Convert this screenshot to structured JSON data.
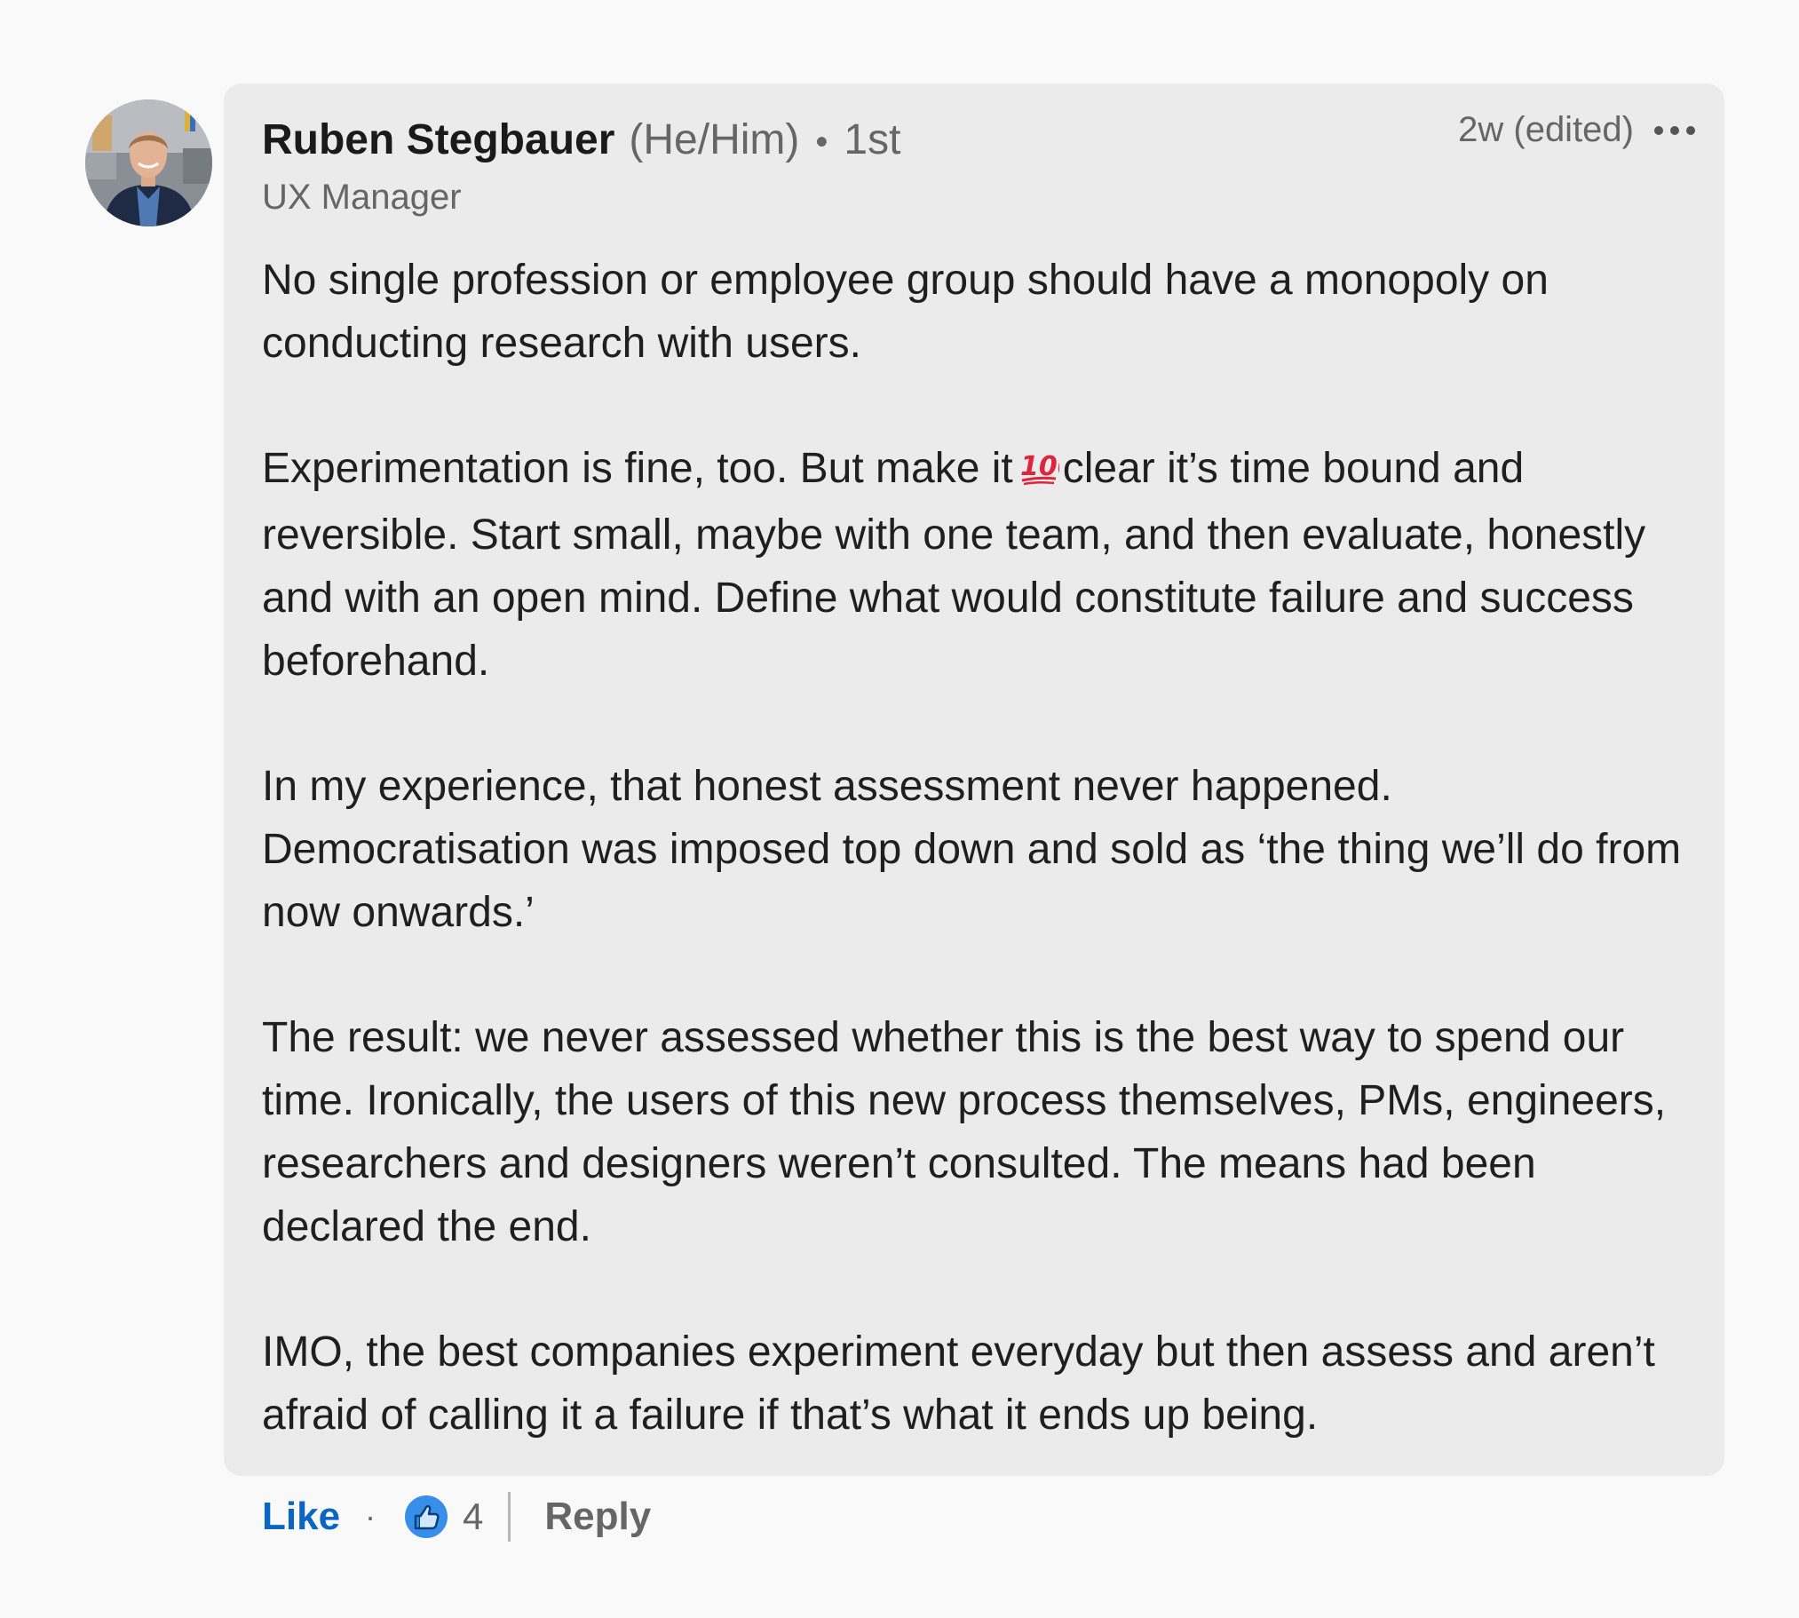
{
  "comment": {
    "author": {
      "name": "Ruben Stegbauer",
      "pronouns": "(He/Him)",
      "separator": "•",
      "degree": "1st",
      "headline": "UX Manager"
    },
    "timestamp": "2w (edited)",
    "paragraphs": {
      "p1": "No single profession or employee group should have a monopoly on conducting research with users.",
      "p2_before_emoji": "Experimentation is fine, too. But make it",
      "p2_after_emoji": "clear it’s time bound and reversible. Start small, maybe with one team, and then evaluate, honestly and with an open mind. Define what would constitute failure and success beforehand.",
      "p3": "In my experience, that honest assessment never happened. Democratisation was imposed top down and sold as ‘the thing we’ll do from now onwards.’",
      "p4": "The result: we never assessed whether this is the best way to spend our time. Ironically, the users of this new process themselves, PMs, engineers, researchers and designers weren’t consulted. The means had been declared the end.",
      "p5": "IMO, the best companies experiment everyday but then assess and aren’t afraid of calling it a failure if that’s what it ends up being."
    },
    "emoji": "hundred-points",
    "actions": {
      "like_label": "Like",
      "dot": "·",
      "reaction_icon": "thumbs-up-icon",
      "reaction_count": "4",
      "reply_label": "Reply"
    }
  },
  "colors": {
    "page_background": "#f9f9f9",
    "bubble_background": "#ebebeb",
    "like_blue": "#0a66c2",
    "secondary_text": "#666666",
    "emoji_red": "#e0243c"
  }
}
